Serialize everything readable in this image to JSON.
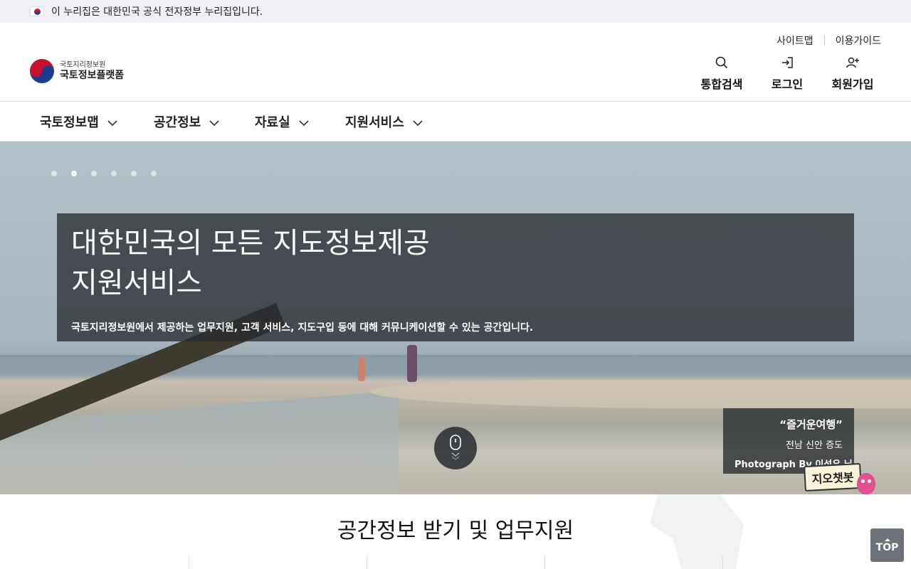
{
  "gov_banner": {
    "text": "이 누리집은 대한민국 공식 전자정부 누리집입니다."
  },
  "logo": {
    "sub": "국토지리정보원",
    "main": "국토정보플랫폼"
  },
  "util_links": [
    {
      "label": "사이트맵"
    },
    {
      "label": "이용가이드"
    }
  ],
  "util_buttons": [
    {
      "label": "통합검색",
      "icon": "search-icon"
    },
    {
      "label": "로그인",
      "icon": "login-icon"
    },
    {
      "label": "회원가입",
      "icon": "user-plus-icon"
    }
  ],
  "nav": [
    {
      "label": "국토정보맵"
    },
    {
      "label": "공간정보"
    },
    {
      "label": "자료실"
    },
    {
      "label": "지원서비스"
    }
  ],
  "hero": {
    "title_line1": "대한민국의 모든 지도정보제공",
    "title_line2": "지원서비스",
    "description": "국토지리정보원에서 제공하는 업무지원, 고객 서비스, 지도구입 등에 대해 커뮤니케이션할 수 있는 공간입니다.",
    "slides_total": 6,
    "active_slide": 2,
    "caption": {
      "title": "“즐거운여행”",
      "place": "전남 신안 증도",
      "photographer": "Photograph By 이성우 님"
    }
  },
  "chatbot": {
    "label": "지오챗봇"
  },
  "section": {
    "title": "공간정보 받기 및 업무지원"
  },
  "top_button": {
    "label": "TOP"
  },
  "colors": {
    "gov_bar": "#eef0f6",
    "hero_box": "#2c3034",
    "top_button": "#6d7178"
  }
}
